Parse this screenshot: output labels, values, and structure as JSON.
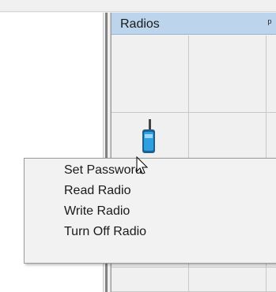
{
  "panel": {
    "title": "Radios",
    "pin_icon": "pin-icon",
    "header_color": "#bcd4ec"
  },
  "grid": {
    "item_icon": "radio-icon"
  },
  "context_menu": {
    "items": [
      {
        "label": "Set Password"
      },
      {
        "label": "Read Radio"
      },
      {
        "label": "Write Radio"
      },
      {
        "label": "Turn Off Radio"
      }
    ]
  },
  "cursor": {
    "icon": "mouse-pointer-icon"
  }
}
